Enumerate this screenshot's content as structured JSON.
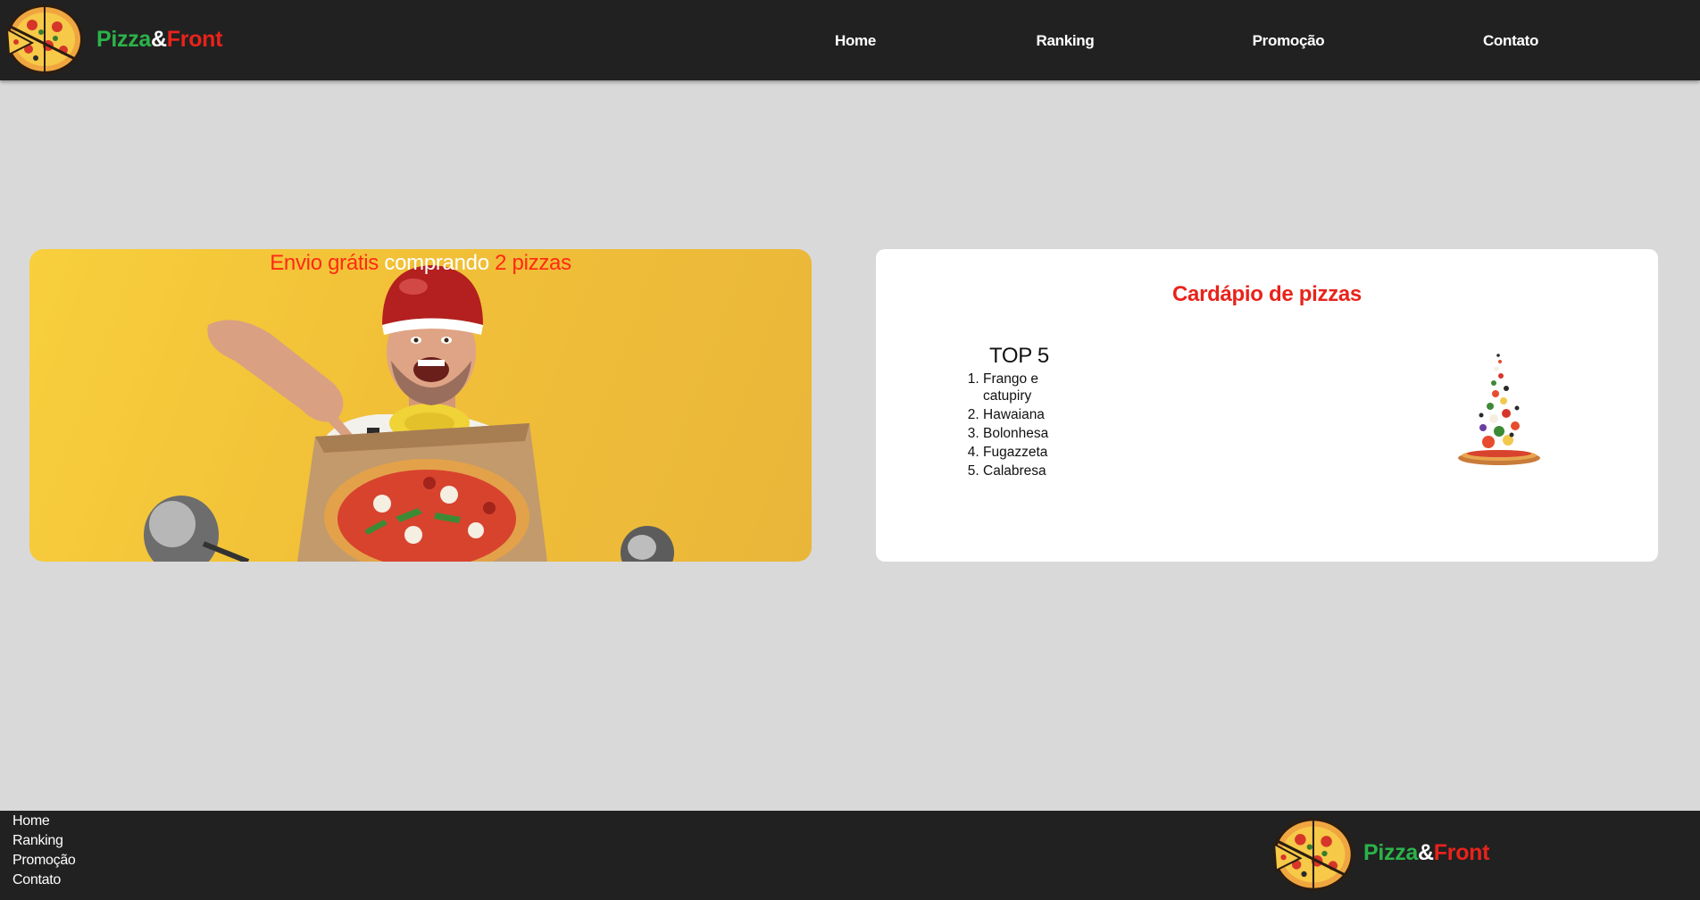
{
  "brand": {
    "part1": "Pizza",
    "ampersand": "&",
    "part2": "Front"
  },
  "nav": {
    "items": [
      {
        "label": "Home"
      },
      {
        "label": "Ranking"
      },
      {
        "label": "Promoção"
      },
      {
        "label": "Contato"
      }
    ]
  },
  "promo": {
    "title_part1": "Envio grátis",
    "title_part2": "comprando",
    "title_part3": "2 pizzas"
  },
  "menu": {
    "title": "Cardápio de pizzas",
    "top_title": "TOP 5",
    "top_items": [
      "Frango e catupiry",
      "Hawaiana",
      "Bolonhesa",
      "Fugazzeta",
      "Calabresa"
    ]
  },
  "footer": {
    "links": [
      "Home",
      "Ranking",
      "Promoção",
      "Contato"
    ]
  },
  "colors": {
    "bar": "#212121",
    "page_bg": "#d9d9d9",
    "green": "#2bb34a",
    "red": "#e8231b",
    "promo_yellow": "#f1c037"
  },
  "icons": {
    "logo": "pizza-logo-icon",
    "promo_image": "delivery-man-with-pizza-image",
    "menu_image": "pizza-ingredients-tower-image"
  }
}
